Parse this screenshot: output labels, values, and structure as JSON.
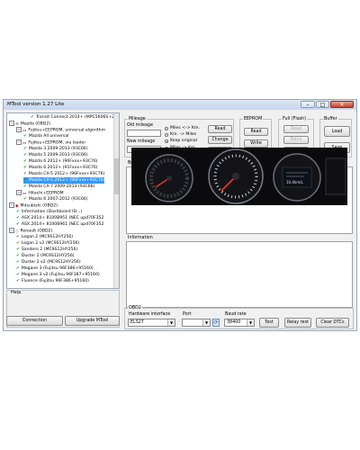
{
  "window": {
    "title": "MTool version 1.27 Lite",
    "btn_min": "–",
    "btn_max": "□",
    "btn_close": "✕"
  },
  "tree": {
    "items": [
      {
        "label": "Transit Connect 2014+ (MPC5606S+24c",
        "level": 3,
        "kind": "check",
        "selected": false
      },
      {
        "label": "Mazda (OBD2)",
        "level": 0,
        "kind": "brand-mazda",
        "selected": false
      },
      {
        "label": "Fujitsu+EEPROM, universal algorithm",
        "level": 1,
        "kind": "node",
        "selected": false
      },
      {
        "label": "Mazda All universal",
        "level": 2,
        "kind": "check",
        "selected": false
      },
      {
        "label": "Fujitsu+EEPROM, via loader",
        "level": 1,
        "kind": "node",
        "selected": false
      },
      {
        "label": "Mazda 3 2009-2013 (93C66)",
        "level": 2,
        "kind": "check",
        "selected": false
      },
      {
        "label": "Mazda 5 2009-2013 (93C66)",
        "level": 2,
        "kind": "check",
        "selected": false
      },
      {
        "label": "Mazda 6 2012+ (96Fxxx+93C76)",
        "level": 2,
        "kind": "check",
        "selected": false
      },
      {
        "label": "Mazda 6 2012+ (91Fxxx+93C76)",
        "level": 2,
        "kind": "check",
        "selected": false
      },
      {
        "label": "Mazda CX-5 2012+ (96Fxxx+93C76)",
        "level": 2,
        "kind": "check",
        "selected": false
      },
      {
        "label": "Mazda CX-5 2012+ (96Fxxx+93C76)",
        "level": 2,
        "kind": "check",
        "selected": true
      },
      {
        "label": "Mazda CX-7 2009-2013 (93C66)",
        "level": 2,
        "kind": "check",
        "selected": false
      },
      {
        "label": "Hitachi+EEPROM",
        "level": 1,
        "kind": "node",
        "selected": false
      },
      {
        "label": "Mazda 6 2007-2012 (93C66)",
        "level": 2,
        "kind": "check",
        "selected": false
      },
      {
        "label": "Mitsubishi (OBD2)",
        "level": 0,
        "kind": "brand-mitsubishi",
        "selected": false
      },
      {
        "label": "Information (Dashboard ID...)",
        "level": 1,
        "kind": "check",
        "selected": false
      },
      {
        "label": "ASX 2014+ 8100B951 (NEC upd70F352",
        "level": 1,
        "kind": "check",
        "selected": false
      },
      {
        "label": "ASX 2014+ 8100B961 (NEC upd70F352",
        "level": 1,
        "kind": "check",
        "selected": false
      },
      {
        "label": "Renault (OBD2)",
        "level": 0,
        "kind": "brand-renault",
        "selected": false
      },
      {
        "label": "Logan 2 (MC9S12HY256)",
        "level": 1,
        "kind": "check",
        "selected": false
      },
      {
        "label": "Logan 2 v2 (MC9S12HY256)",
        "level": 1,
        "kind": "check",
        "selected": false
      },
      {
        "label": "Sandero 2 (MC9S12HY256)",
        "level": 1,
        "kind": "check",
        "selected": false
      },
      {
        "label": "Duster 2 (MC9S12HY256)",
        "level": 1,
        "kind": "check",
        "selected": false
      },
      {
        "label": "Duster 2 v2 (MC9S12HY256)",
        "level": 1,
        "kind": "check",
        "selected": false
      },
      {
        "label": "Megane 3 (Fujitsu 96F386+95160)",
        "level": 1,
        "kind": "check",
        "selected": false
      },
      {
        "label": "Megane 3 v2 (Fujitsu 96F387+95160)",
        "level": 1,
        "kind": "check",
        "selected": false
      },
      {
        "label": "Fluence (Fujitsu 96F386+95160)",
        "level": 1,
        "kind": "check",
        "selected": false
      }
    ]
  },
  "help": {
    "label": "Help",
    "connection_label": "Connection",
    "upgrade_label": "Upgrade MTool"
  },
  "mileage": {
    "label": "Mileage",
    "old_label": "Old mileage",
    "new_label": "New mileage",
    "old_value": "",
    "new_value": "",
    "opt_miles_km": "Miles <-> Km.",
    "opt_km_miles": "Km. -> Miles",
    "opt_keep": "Keep original",
    "opt_miles_km2": "Miles -> Km.",
    "read_label": "Read",
    "change_label": "Change",
    "write_label": "Write"
  },
  "eeprom": {
    "label": "EEPROM",
    "read_label": "Read",
    "write_label": "Write"
  },
  "flash": {
    "label": "Full (Flash)",
    "read_label": "Read",
    "patch_label": "Patch",
    "write_label": "Write"
  },
  "buffer_group": {
    "label": "Buffer",
    "load_label": "Load",
    "save_label": "Save"
  },
  "buffer": {
    "label": "Buffer"
  },
  "information": {
    "label": "Information"
  },
  "obd": {
    "label": "OBD2",
    "hw_label": "Hardware interface",
    "hw_value": "ELS27",
    "port_label": "Port",
    "port_value": "",
    "baud_label": "Baud rate",
    "baud_value": "38400",
    "test_label": "Test",
    "relay_label": "Relay test",
    "clear_label": "Clear DTCs"
  },
  "dashboard": {
    "odometer": "10.4km/L"
  },
  "colors": {
    "selection": "#3399ff",
    "check": "#14a014",
    "window_bg": "#f0f0f0"
  }
}
